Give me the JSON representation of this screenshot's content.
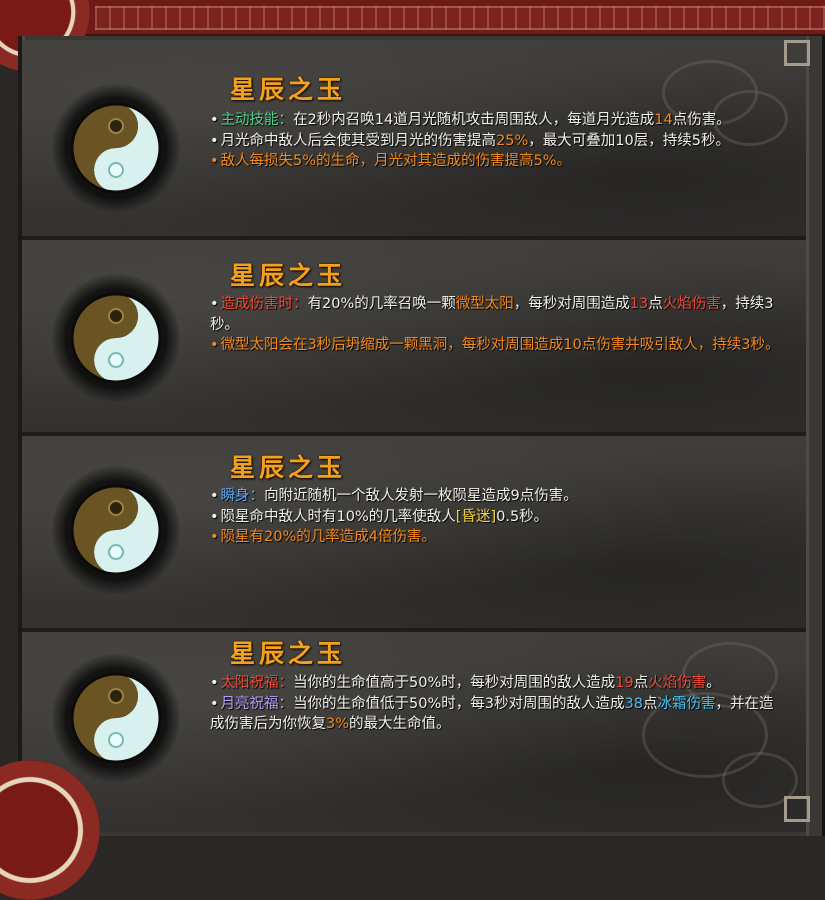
{
  "colors": {
    "title": "#f4a21c",
    "body_text": "#f1efe9",
    "skill_green": "#52d08a",
    "orange": "#f38a1e",
    "red": "#ef4a37",
    "blue": "#5ea9f2",
    "yellow": "#f0d447",
    "purple": "#b79cf4",
    "cyan": "#49c1f0",
    "frame_red": "#6e1a17"
  },
  "cards": [
    {
      "icon": "yin-yang-jade-icon",
      "title": "星辰之玉",
      "lines": [
        {
          "bullet": "•",
          "segments": [
            {
              "text": "主动技能：",
              "color": "green"
            },
            {
              "text": "在2秒内召唤14道月光随机攻击周围敌人，每道月光造成",
              "color": "white"
            },
            {
              "text": "14",
              "color": "orange"
            },
            {
              "text": "点伤害。",
              "color": "white"
            }
          ]
        },
        {
          "bullet": "•",
          "segments": [
            {
              "text": "月光命中敌人后会使其受到月光的伤害提高",
              "color": "white"
            },
            {
              "text": "25%",
              "color": "orange"
            },
            {
              "text": "，最大可叠加10层，持续5秒。",
              "color": "white"
            }
          ]
        },
        {
          "bullet": "•",
          "bullet_color": "orange",
          "segments": [
            {
              "text": "敌人每损失5%的生命，月光对其造成的伤害提高5%。",
              "color": "orange"
            }
          ]
        }
      ]
    },
    {
      "icon": "yin-yang-jade-icon",
      "title": "星辰之玉",
      "lines": [
        {
          "bullet": "•",
          "segments": [
            {
              "text": "造成伤害时：",
              "color": "red"
            },
            {
              "text": "有20%的几率召唤一颗",
              "color": "white"
            },
            {
              "text": "微型太阳",
              "color": "orange"
            },
            {
              "text": "，每秒对周围造成",
              "color": "white"
            },
            {
              "text": "13",
              "color": "red"
            },
            {
              "text": "点",
              "color": "white"
            },
            {
              "text": "火焰伤害",
              "color": "red"
            },
            {
              "text": "，持续3秒。",
              "color": "white"
            }
          ]
        },
        {
          "bullet": "•",
          "bullet_color": "orange",
          "segments": [
            {
              "text": "微型太阳会在3秒后坍缩成一颗黑洞，每秒对周围造成10点伤害并吸引敌人，持续3秒。",
              "color": "orange"
            }
          ]
        }
      ]
    },
    {
      "icon": "yin-yang-jade-icon",
      "title": "星辰之玉",
      "lines": [
        {
          "bullet": "•",
          "segments": [
            {
              "text": "瞬身：",
              "color": "blue"
            },
            {
              "text": "向附近随机一个敌人发射一枚陨星造成9点伤害。",
              "color": "white"
            }
          ]
        },
        {
          "bullet": "•",
          "segments": [
            {
              "text": "陨星命中敌人时有10%的几率使敌人",
              "color": "white"
            },
            {
              "text": "[昏迷]",
              "color": "yellow"
            },
            {
              "text": "0.5秒。",
              "color": "white"
            }
          ]
        },
        {
          "bullet": "•",
          "bullet_color": "orange",
          "segments": [
            {
              "text": "陨星有20%的几率造成4倍伤害。",
              "color": "orange"
            }
          ]
        }
      ]
    },
    {
      "icon": "yin-yang-jade-icon",
      "title": "星辰之玉",
      "lines": [
        {
          "bullet": "•",
          "segments": [
            {
              "text": "太阳祝福：",
              "color": "red"
            },
            {
              "text": "当你的生命值高于50%时，每秒对周围的敌人造成",
              "color": "white"
            },
            {
              "text": "19",
              "color": "red"
            },
            {
              "text": "点",
              "color": "white"
            },
            {
              "text": "火焰伤害",
              "color": "red"
            },
            {
              "text": "。",
              "color": "white"
            }
          ]
        },
        {
          "bullet": "•",
          "segments": [
            {
              "text": "月亮祝福：",
              "color": "purple"
            },
            {
              "text": "当你的生命值低于50%时，每3秒对周围的敌人造成",
              "color": "white"
            },
            {
              "text": "38",
              "color": "cyan"
            },
            {
              "text": "点",
              "color": "white"
            },
            {
              "text": "冰霜伤害",
              "color": "cyan"
            },
            {
              "text": "，并在造成伤害后为你恢复",
              "color": "white"
            },
            {
              "text": "3%",
              "color": "orange"
            },
            {
              "text": "的最大生命值。",
              "color": "white"
            }
          ]
        }
      ]
    }
  ]
}
